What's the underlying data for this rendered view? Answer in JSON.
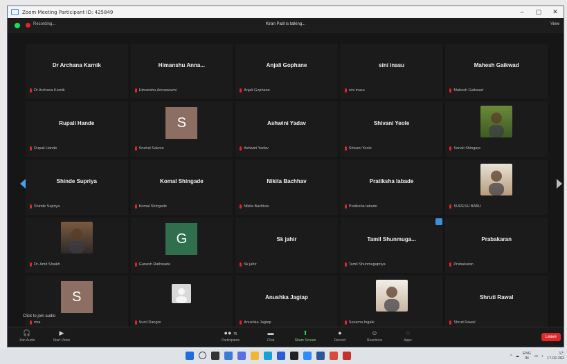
{
  "window": {
    "title": "Zoom Meeting Participant ID: 425849",
    "controls": [
      "–",
      "▢",
      "✕"
    ]
  },
  "topbar": {
    "recording_label": "Recording...",
    "talking_text": "Kiran Patil is talking...",
    "view_label": "View"
  },
  "colors": {
    "accent": "#2d8cff",
    "mic_muted": "#e0242d",
    "share_green": "#2fbe58",
    "leave_red": "#e02828",
    "tile_bg": "#1b1b1b"
  },
  "tiles": [
    {
      "display": "Dr Archana Karnik",
      "label": "Dr Archana Karnik"
    },
    {
      "display": "Himanshu  Anna...",
      "label": "Himanshu Annaswami"
    },
    {
      "display": "Anjali Gophane",
      "label": "Anjali Gophane"
    },
    {
      "display": "sini inasu",
      "label": "sini inasu"
    },
    {
      "display": "Mahesh Gaikwad",
      "label": "Mahesh Gaikwad"
    },
    {
      "display": "Rupali Hande",
      "label": "Rupali Hande"
    },
    {
      "display": "",
      "label": "Snehal Sakore",
      "avatar_letter": "S",
      "avatar_color": "#8c6e62"
    },
    {
      "display": "Ashwini Yadav",
      "label": "Ashwini Yadav"
    },
    {
      "display": "Shivani Yeole",
      "label": "Shivani Yeole"
    },
    {
      "display": "",
      "label": "Sonali Shingare",
      "photo": "outdoor-portrait"
    },
    {
      "display": "Shinde Supriya",
      "label": "Shinde Supriya"
    },
    {
      "display": "Komal Shingade",
      "label": "Komal Shingade"
    },
    {
      "display": "Nikita Bachhav",
      "label": "Nikita Bachhav"
    },
    {
      "display": "Pratiksha labade",
      "label": "Pratiksha labade"
    },
    {
      "display": "",
      "label": "SURESH BABU",
      "photo": "man-portrait"
    },
    {
      "display": "",
      "label": "Dr. Amit Shaikh",
      "photo": "man-glasses"
    },
    {
      "display": "",
      "label": "Ganesh Rathwade",
      "avatar_letter": "G",
      "avatar_color": "#2f6f4d"
    },
    {
      "display": "Sk jahir",
      "label": "Sk jahir"
    },
    {
      "display": "Tamil  Shunmuga...",
      "label": "Tamil Shunmugapriya"
    },
    {
      "display": "Prabakaran",
      "label": "Prabakaran"
    },
    {
      "display": "",
      "label": "rma",
      "avatar_letter": "S",
      "avatar_color": "#8c6e62"
    },
    {
      "display": "",
      "label": "Sunil Dangre",
      "photo": "default-avatar"
    },
    {
      "display": "Anushka  Jagtap",
      "label": "Anushka Jagtap"
    },
    {
      "display": "",
      "label": "Suvarna Ingale",
      "photo": "woman-portrait"
    },
    {
      "display": "Shruti Rawal",
      "label": "Shruti Rawal"
    }
  ],
  "join_audio_text": "Click to join audio",
  "toolbar": {
    "join_audio": "Join Audio",
    "start_video": "Start Video",
    "participants": "Participants",
    "participants_count": "75",
    "chat": "Chat",
    "share_screen": "Share Screen",
    "record": "Record",
    "reactions": "Reactions",
    "apps": "Apps",
    "leave": "Leave"
  },
  "taskbar": {
    "lang": "ENG",
    "region": "IN",
    "time": "17:",
    "date": "17-02-202"
  }
}
